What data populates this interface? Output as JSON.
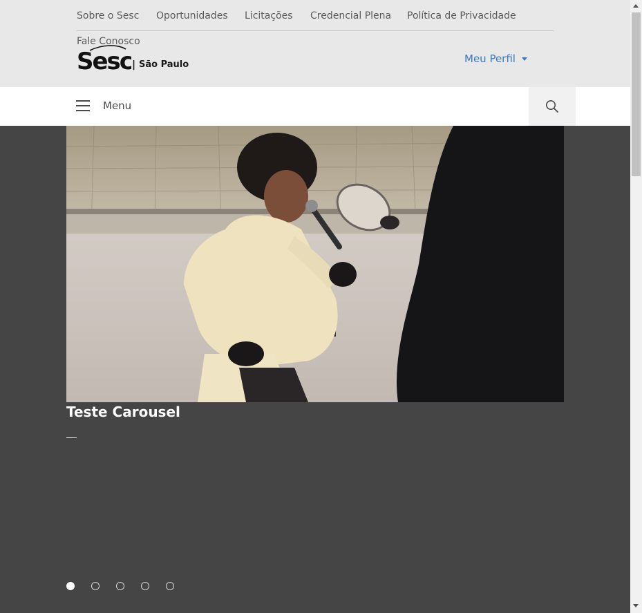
{
  "utility_nav": {
    "items": [
      "Sobre o Sesc",
      "Oportunidades",
      "Licitações",
      "Credencial Plena",
      "Política de Privacidade",
      "Fale Conosco"
    ]
  },
  "brand": {
    "logo_text": "Sesc",
    "separator": "|",
    "city": "São Paulo"
  },
  "profile": {
    "label": "Meu Perfil",
    "color": "#3a78c4"
  },
  "menu_bar": {
    "menu_label": "Menu",
    "icons": [
      "hamburger-icon",
      "search-icon"
    ]
  },
  "carousel": {
    "slide_title": "Teste Carousel",
    "slide_count": 5,
    "active_slide": 1
  },
  "colors": {
    "header_bg": "#e8e8e8",
    "hero_bg": "#454545",
    "link": "#3a78c4"
  }
}
